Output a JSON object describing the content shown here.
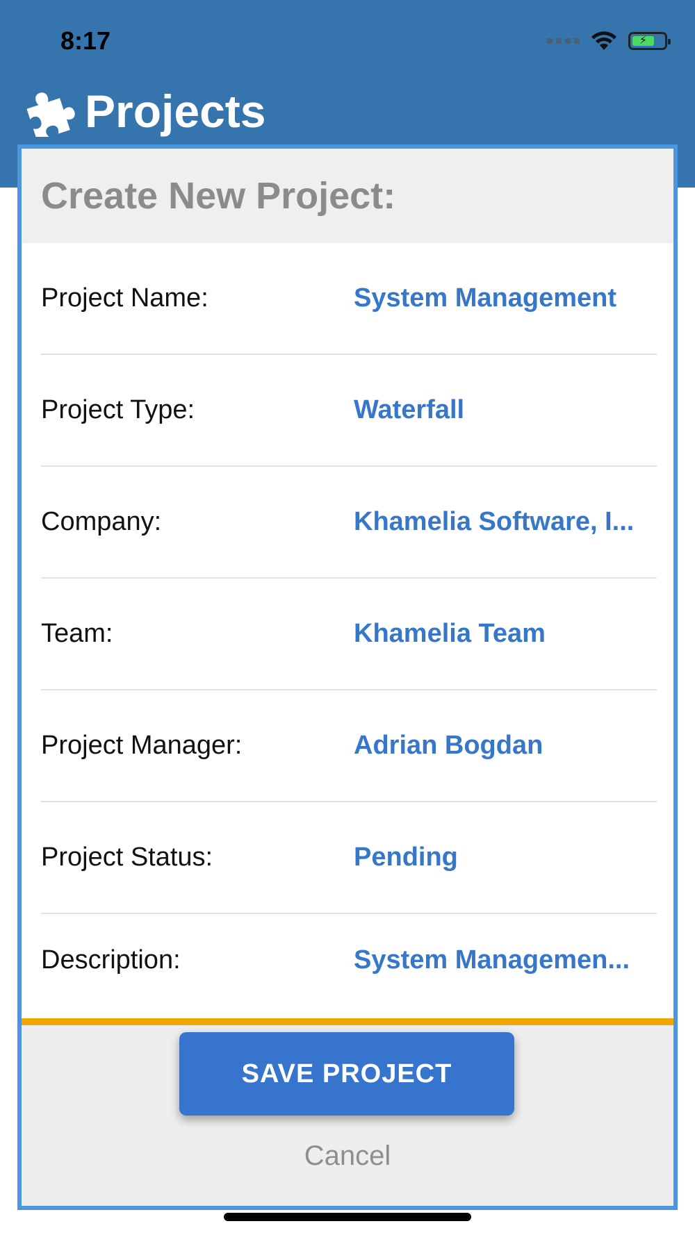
{
  "status_bar": {
    "time": "8:17",
    "icons": [
      "signal-icon",
      "wifi-icon",
      "battery-charging-icon"
    ]
  },
  "app_bar": {
    "title": "Projects",
    "icon": "puzzle-piece-icon",
    "color": "#3674ad"
  },
  "dialog": {
    "title": "Create New Project:",
    "accent_color": "#f0a800",
    "border_color": "#4a97e0",
    "fields": [
      {
        "label": "Project Name:",
        "value": "System Management"
      },
      {
        "label": "Project Type:",
        "value": "Waterfall"
      },
      {
        "label": "Company:",
        "value": "Khamelia Software, I..."
      },
      {
        "label": "Team:",
        "value": "Khamelia Team"
      },
      {
        "label": "Project Manager:",
        "value": "Adrian Bogdan"
      },
      {
        "label": "Project Status:",
        "value": "Pending"
      },
      {
        "label": "Description:",
        "value": "System Managemen..."
      }
    ],
    "save_label": "SAVE PROJECT",
    "cancel_label": "Cancel"
  }
}
